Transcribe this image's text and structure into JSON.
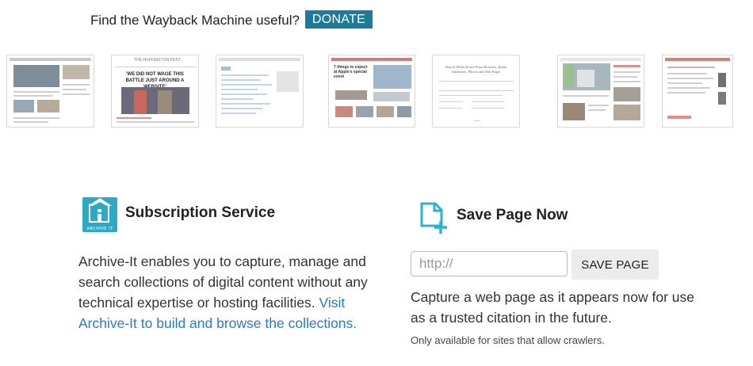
{
  "donate": {
    "text": "Find the Wayback Machine useful?",
    "button_label": "DONATE"
  },
  "thumbnails": [
    {
      "name": "site-snapshot-1"
    },
    {
      "name": "site-snapshot-2",
      "headline": "'WE DID NOT WAGE THIS BATTLE JUST AROUND A WEBSITE'",
      "masthead": "THE HUFFINGTON POST"
    },
    {
      "name": "site-snapshot-3"
    },
    {
      "name": "site-snapshot-4",
      "headline": "7 things to expect at Apple's special event"
    },
    {
      "name": "site-snapshot-5",
      "headline": "Search White House Press Releases, Radio Addresses, Photos and Web Pages"
    },
    {
      "name": "site-snapshot-6"
    },
    {
      "name": "site-snapshot-7"
    }
  ],
  "subscription": {
    "icon": "archive-it-icon",
    "icon_text": "ARCHIVE IT",
    "title": "Subscription Service",
    "body": "Archive-It enables you to capture, manage and search collections of digital content without any technical expertise or hosting facilities.",
    "link_text": "Visit Archive-It to build and browse the collections.",
    "accent_color": "#2fa8c6",
    "link_color": "#2b7bc4"
  },
  "save_page": {
    "icon": "save-page-icon",
    "title": "Save Page Now",
    "input_placeholder": "http://",
    "button_label": "SAVE PAGE",
    "body": "Capture a web page as it appears now for use as a trusted citation in the future.",
    "note": "Only available for sites that allow crawlers."
  },
  "colors": {
    "donate_button": "#1b7b99",
    "save_icon": "#29b3d0"
  }
}
